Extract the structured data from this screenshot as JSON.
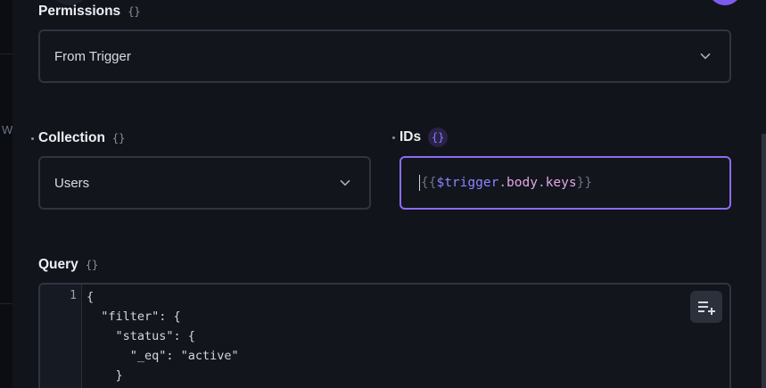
{
  "permissions": {
    "label": "Permissions",
    "braces": "{}",
    "value": "From Trigger"
  },
  "backdrop": {
    "partial_letter": "W"
  },
  "collection": {
    "label": "Collection",
    "braces": "{}",
    "value": "Users"
  },
  "ids": {
    "label": "IDs",
    "braces": "{}",
    "tokens": {
      "open": "{{",
      "var": "$trigger",
      "dot1": ".",
      "prop1": "body",
      "dot2": ".",
      "prop2": "keys",
      "close": "}}"
    }
  },
  "query": {
    "label": "Query",
    "braces": "{}",
    "line_number": "1",
    "code_lines": [
      "{",
      "  \"filter\": {",
      "    \"status\": {",
      "      \"_eq\": \"active\"",
      "    }"
    ]
  },
  "icons": {
    "chevron": "chevron-down-icon",
    "format": "format-list-add-icon"
  },
  "colors": {
    "accent": "#8b6cf0",
    "border": "#2f3440",
    "background": "#11141b"
  }
}
